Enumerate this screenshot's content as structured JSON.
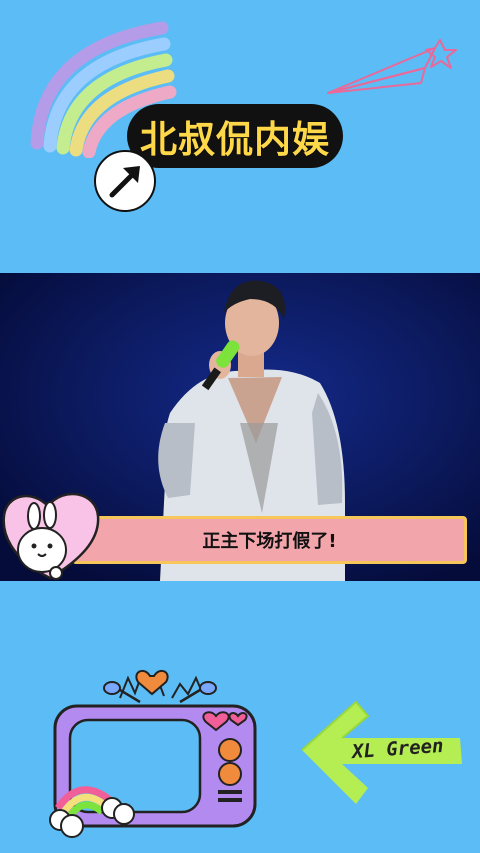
{
  "header": {
    "title": "北叔侃内娱"
  },
  "video": {
    "caption": "正主下场打假了!"
  },
  "sticker": {
    "arrow_label": "XL Green"
  },
  "icons": {
    "rainbow": "rainbow-icon",
    "paper_plane": "paper-plane-icon",
    "arrow_badge": "arrow-up-right-icon",
    "heart_bunny": "heart-bunny-icon",
    "tv": "retro-tv-icon",
    "arrow_left": "arrow-left-icon"
  },
  "colors": {
    "background": "#5cbcf5",
    "title_pill": "#111111",
    "title_text": "#ffd84a",
    "caption_bg": "#f2a6ab",
    "caption_border": "#f6c65a",
    "arrow_sticker": "#b8f04a"
  }
}
